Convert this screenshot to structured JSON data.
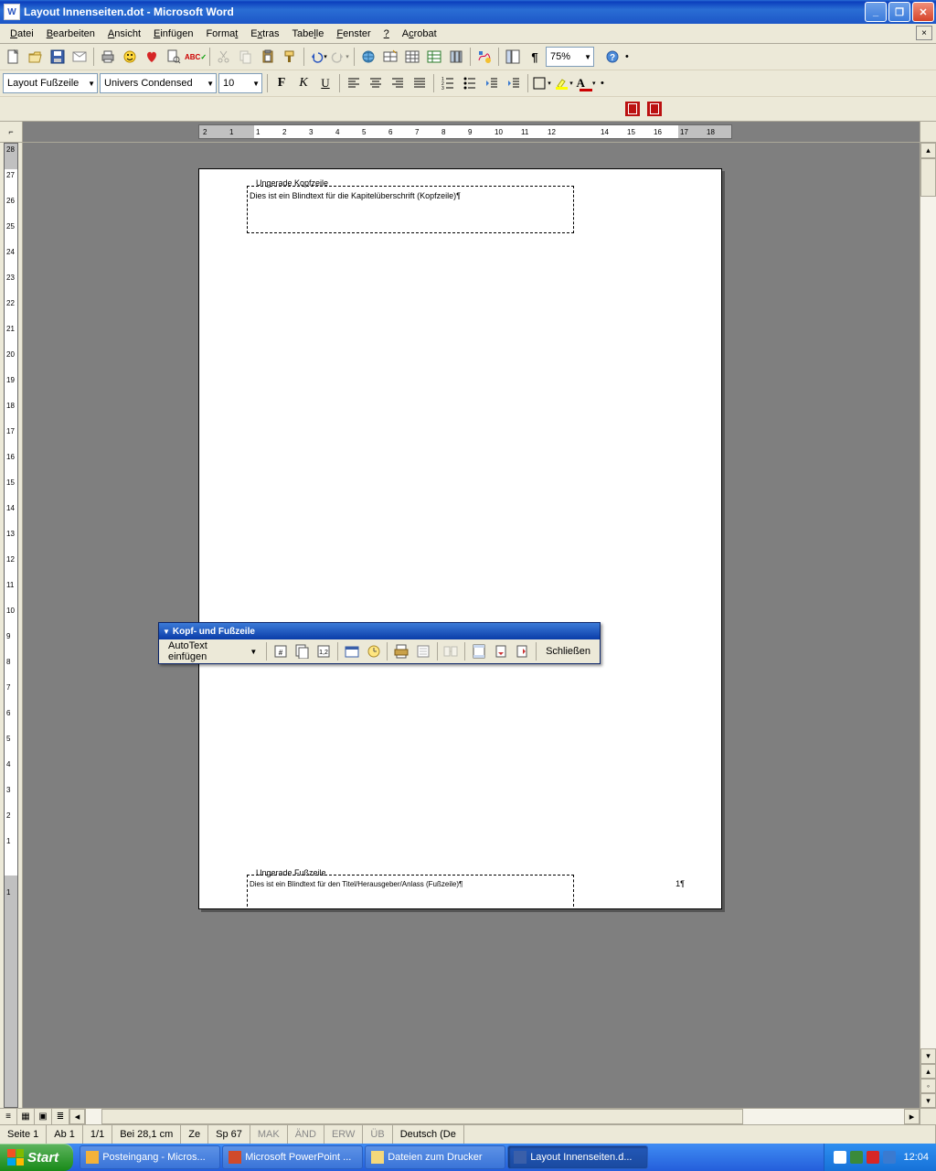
{
  "title": "Layout Innenseiten.dot - Microsoft Word",
  "menu": [
    "Datei",
    "Bearbeiten",
    "Ansicht",
    "Einfügen",
    "Format",
    "Extras",
    "Tabelle",
    "Fenster",
    "?",
    "Acrobat"
  ],
  "menuUnderlineIdx": [
    0,
    0,
    0,
    0,
    3,
    1,
    5,
    3,
    0,
    1
  ],
  "zoom": "75%",
  "style": "Layout Fußzeile",
  "font": "Univers Condensed",
  "fontsize": "10",
  "header": {
    "label": "Ungerade Kopfzeile",
    "text": "Dies ist ein Blindtext für die Kapitelüberschrift (Kopfzeile)¶"
  },
  "footer": {
    "label": "Ungerade Fußzeile",
    "text": "Dies ist ein Blindtext für den Titel/Herausgeber/Anlass (Fußzeile)¶"
  },
  "pagemark": "1¶",
  "floatTitle": "Kopf- und Fußzeile",
  "autotext": "AutoText einfügen",
  "floatClose": "Schließen",
  "status": {
    "seite": "Seite  1",
    "ab": "Ab  1",
    "pages": "1/1",
    "bei": "Bei  28,1 cm",
    "ze": "Ze",
    "sp": "Sp  67",
    "mak": "MAK",
    "and": "ÄND",
    "erw": "ERW",
    "ub": "ÜB",
    "lang": "Deutsch (De"
  },
  "taskbar": {
    "start": "Start",
    "items": [
      "Posteingang - Micros...",
      "Microsoft PowerPoint ...",
      "Dateien zum Drucker",
      "Layout Innenseiten.d..."
    ],
    "clock": "12:04"
  },
  "rulerH": [
    "2",
    "1",
    "1",
    "2",
    "3",
    "4",
    "5",
    "6",
    "7",
    "8",
    "9",
    "10",
    "11",
    "12",
    "",
    "14",
    "15",
    "16",
    "17",
    "18"
  ],
  "rulerV": [
    "28",
    "27",
    "26",
    "25",
    "24",
    "23",
    "22",
    "21",
    "20",
    "19",
    "18",
    "17",
    "16",
    "15",
    "14",
    "13",
    "12",
    "11",
    "10",
    "9",
    "8",
    "7",
    "6",
    "5",
    "4",
    "3",
    "2",
    "1",
    "",
    "1"
  ]
}
